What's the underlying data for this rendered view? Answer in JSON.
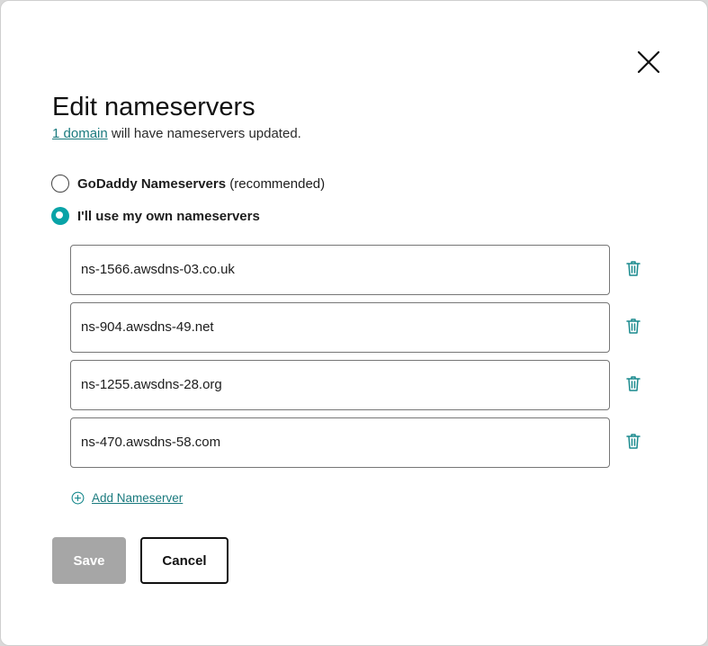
{
  "dialog": {
    "title": "Edit nameservers",
    "subtitle_link": "1 domain",
    "subtitle_rest": " will have nameservers updated."
  },
  "options": {
    "godaddy": {
      "label": "GoDaddy Nameservers",
      "note": "(recommended)",
      "checked": false
    },
    "custom": {
      "label": "I'll use my own nameservers",
      "checked": true
    }
  },
  "nameservers": [
    "ns-1566.awsdns-03.co.uk",
    "ns-904.awsdns-49.net",
    "ns-1255.awsdns-28.org",
    "ns-470.awsdns-58.com"
  ],
  "add_nameserver_label": "Add Nameserver",
  "buttons": {
    "save": "Save",
    "cancel": "Cancel"
  },
  "icons": {
    "close": "close-icon",
    "trash": "trash-icon",
    "add": "plus-circle-icon"
  },
  "colors": {
    "accent": "#09a3a7",
    "link": "#1a7a7e",
    "disabled_button": "#a6a6a6"
  }
}
